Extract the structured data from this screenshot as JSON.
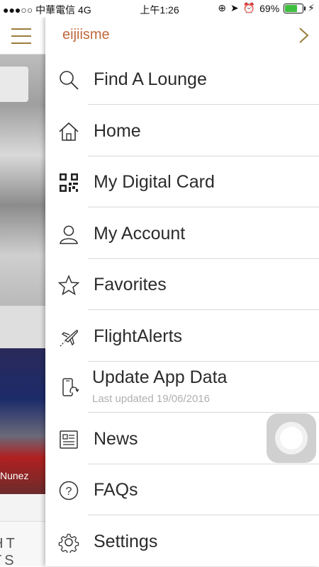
{
  "status_bar": {
    "carrier": "●●●○○ 中華電信  4G",
    "time": "上午1:26",
    "battery": "69%",
    "battery_level": 0.69
  },
  "background_app": {
    "caption": "Nunez",
    "bottom_line1": "HT",
    "bottom_line2": "TS"
  },
  "drawer": {
    "app_name": "eijiisme",
    "items": [
      {
        "label": "Find A Lounge",
        "icon": "search-icon"
      },
      {
        "label": "Home",
        "icon": "home-icon"
      },
      {
        "label": "My Digital Card",
        "icon": "qr-code-icon"
      },
      {
        "label": "My Account",
        "icon": "user-icon"
      },
      {
        "label": "Favorites",
        "icon": "star-icon"
      },
      {
        "label": "FlightAlerts",
        "icon": "airplane-icon"
      },
      {
        "label": "Update App Data",
        "sublabel": "Last updated 19/06/2016",
        "icon": "phone-sync-icon"
      },
      {
        "label": "News",
        "icon": "news-icon"
      },
      {
        "label": "FAQs",
        "icon": "question-icon"
      },
      {
        "label": "Settings",
        "icon": "gear-icon"
      }
    ]
  },
  "colors": {
    "accent": "#c0683a",
    "hamburger": "#9a7c3c",
    "text": "#2b2b2b",
    "sublabel": "#b0b0b0"
  }
}
